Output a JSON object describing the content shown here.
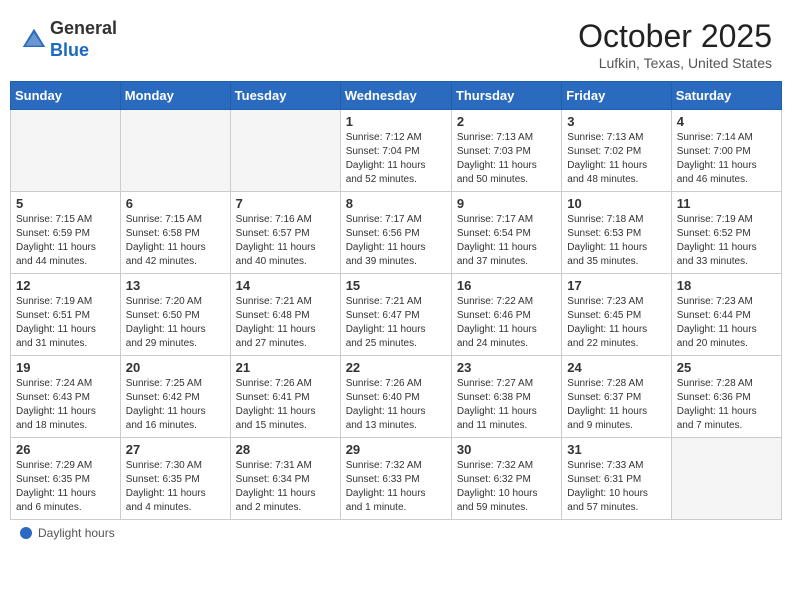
{
  "header": {
    "logo_line1": "General",
    "logo_line2": "Blue",
    "month": "October 2025",
    "location": "Lufkin, Texas, United States"
  },
  "days_of_week": [
    "Sunday",
    "Monday",
    "Tuesday",
    "Wednesday",
    "Thursday",
    "Friday",
    "Saturday"
  ],
  "weeks": [
    [
      {
        "num": "",
        "info": ""
      },
      {
        "num": "",
        "info": ""
      },
      {
        "num": "",
        "info": ""
      },
      {
        "num": "1",
        "info": "Sunrise: 7:12 AM\nSunset: 7:04 PM\nDaylight: 11 hours\nand 52 minutes."
      },
      {
        "num": "2",
        "info": "Sunrise: 7:13 AM\nSunset: 7:03 PM\nDaylight: 11 hours\nand 50 minutes."
      },
      {
        "num": "3",
        "info": "Sunrise: 7:13 AM\nSunset: 7:02 PM\nDaylight: 11 hours\nand 48 minutes."
      },
      {
        "num": "4",
        "info": "Sunrise: 7:14 AM\nSunset: 7:00 PM\nDaylight: 11 hours\nand 46 minutes."
      }
    ],
    [
      {
        "num": "5",
        "info": "Sunrise: 7:15 AM\nSunset: 6:59 PM\nDaylight: 11 hours\nand 44 minutes."
      },
      {
        "num": "6",
        "info": "Sunrise: 7:15 AM\nSunset: 6:58 PM\nDaylight: 11 hours\nand 42 minutes."
      },
      {
        "num": "7",
        "info": "Sunrise: 7:16 AM\nSunset: 6:57 PM\nDaylight: 11 hours\nand 40 minutes."
      },
      {
        "num": "8",
        "info": "Sunrise: 7:17 AM\nSunset: 6:56 PM\nDaylight: 11 hours\nand 39 minutes."
      },
      {
        "num": "9",
        "info": "Sunrise: 7:17 AM\nSunset: 6:54 PM\nDaylight: 11 hours\nand 37 minutes."
      },
      {
        "num": "10",
        "info": "Sunrise: 7:18 AM\nSunset: 6:53 PM\nDaylight: 11 hours\nand 35 minutes."
      },
      {
        "num": "11",
        "info": "Sunrise: 7:19 AM\nSunset: 6:52 PM\nDaylight: 11 hours\nand 33 minutes."
      }
    ],
    [
      {
        "num": "12",
        "info": "Sunrise: 7:19 AM\nSunset: 6:51 PM\nDaylight: 11 hours\nand 31 minutes."
      },
      {
        "num": "13",
        "info": "Sunrise: 7:20 AM\nSunset: 6:50 PM\nDaylight: 11 hours\nand 29 minutes."
      },
      {
        "num": "14",
        "info": "Sunrise: 7:21 AM\nSunset: 6:48 PM\nDaylight: 11 hours\nand 27 minutes."
      },
      {
        "num": "15",
        "info": "Sunrise: 7:21 AM\nSunset: 6:47 PM\nDaylight: 11 hours\nand 25 minutes."
      },
      {
        "num": "16",
        "info": "Sunrise: 7:22 AM\nSunset: 6:46 PM\nDaylight: 11 hours\nand 24 minutes."
      },
      {
        "num": "17",
        "info": "Sunrise: 7:23 AM\nSunset: 6:45 PM\nDaylight: 11 hours\nand 22 minutes."
      },
      {
        "num": "18",
        "info": "Sunrise: 7:23 AM\nSunset: 6:44 PM\nDaylight: 11 hours\nand 20 minutes."
      }
    ],
    [
      {
        "num": "19",
        "info": "Sunrise: 7:24 AM\nSunset: 6:43 PM\nDaylight: 11 hours\nand 18 minutes."
      },
      {
        "num": "20",
        "info": "Sunrise: 7:25 AM\nSunset: 6:42 PM\nDaylight: 11 hours\nand 16 minutes."
      },
      {
        "num": "21",
        "info": "Sunrise: 7:26 AM\nSunset: 6:41 PM\nDaylight: 11 hours\nand 15 minutes."
      },
      {
        "num": "22",
        "info": "Sunrise: 7:26 AM\nSunset: 6:40 PM\nDaylight: 11 hours\nand 13 minutes."
      },
      {
        "num": "23",
        "info": "Sunrise: 7:27 AM\nSunset: 6:38 PM\nDaylight: 11 hours\nand 11 minutes."
      },
      {
        "num": "24",
        "info": "Sunrise: 7:28 AM\nSunset: 6:37 PM\nDaylight: 11 hours\nand 9 minutes."
      },
      {
        "num": "25",
        "info": "Sunrise: 7:28 AM\nSunset: 6:36 PM\nDaylight: 11 hours\nand 7 minutes."
      }
    ],
    [
      {
        "num": "26",
        "info": "Sunrise: 7:29 AM\nSunset: 6:35 PM\nDaylight: 11 hours\nand 6 minutes."
      },
      {
        "num": "27",
        "info": "Sunrise: 7:30 AM\nSunset: 6:35 PM\nDaylight: 11 hours\nand 4 minutes."
      },
      {
        "num": "28",
        "info": "Sunrise: 7:31 AM\nSunset: 6:34 PM\nDaylight: 11 hours\nand 2 minutes."
      },
      {
        "num": "29",
        "info": "Sunrise: 7:32 AM\nSunset: 6:33 PM\nDaylight: 11 hours\nand 1 minute."
      },
      {
        "num": "30",
        "info": "Sunrise: 7:32 AM\nSunset: 6:32 PM\nDaylight: 10 hours\nand 59 minutes."
      },
      {
        "num": "31",
        "info": "Sunrise: 7:33 AM\nSunset: 6:31 PM\nDaylight: 10 hours\nand 57 minutes."
      },
      {
        "num": "",
        "info": ""
      }
    ]
  ],
  "footer": {
    "label": "Daylight hours"
  }
}
